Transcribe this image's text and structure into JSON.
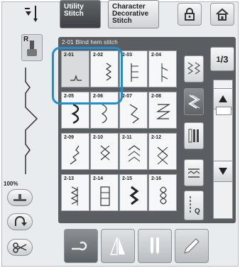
{
  "tabs": {
    "utility": "Utility\nStitch",
    "character": "Character\nDecorative\nStitch"
  },
  "left": {
    "presser_foot_letter": "R",
    "zoom": "100%"
  },
  "panel": {
    "header": "2-01  Blind hem stitch",
    "page": "1/3",
    "page_num": "1",
    "page_den": "3",
    "selected_stitch": "2-01"
  },
  "stitches": [
    {
      "code": "2-01",
      "icon": "blind-hem-stitch-icon"
    },
    {
      "code": "2-02",
      "icon": "blind-hem-elastic-stitch-icon"
    },
    {
      "code": "2-03",
      "icon": "blanket-stitch-icon"
    },
    {
      "code": "2-04",
      "icon": "shell-tuck-stitch-icon"
    },
    {
      "code": "2-05",
      "icon": "scallop-stitch-icon"
    },
    {
      "code": "2-06",
      "icon": "scallop-satin-stitch-icon"
    },
    {
      "code": "2-07",
      "icon": "patchwork-zigzag-icon"
    },
    {
      "code": "2-08",
      "icon": "patchwork-double-overlock-icon"
    },
    {
      "code": "2-09",
      "icon": "couching-stitch-icon"
    },
    {
      "code": "2-10",
      "icon": "smocking-stitch-icon"
    },
    {
      "code": "2-11",
      "icon": "feather-stitch-icon"
    },
    {
      "code": "2-12",
      "icon": "fagoting-cross-stitch-icon"
    },
    {
      "code": "2-13",
      "icon": "tape-attaching-stitch-icon"
    },
    {
      "code": "2-14",
      "icon": "ladder-stitch-icon"
    },
    {
      "code": "2-15",
      "icon": "rick-rack-stitch-icon"
    },
    {
      "code": "2-16",
      "icon": "decorative-stitch-icon"
    }
  ],
  "side_buttons": [
    "stitch-width-icon",
    "mirror-stitch-icon",
    "stitch-length-icon",
    "tension-icon",
    "needle-q-icon"
  ],
  "bottom_buttons": [
    "thread-cutter-icon",
    "mirror-image-icon",
    "twin-needle-icon",
    "pencil-icon"
  ],
  "colors": {
    "highlight": "#1f8fd4",
    "panel": "#5a5e62",
    "active_tab": "#4a4e52"
  }
}
